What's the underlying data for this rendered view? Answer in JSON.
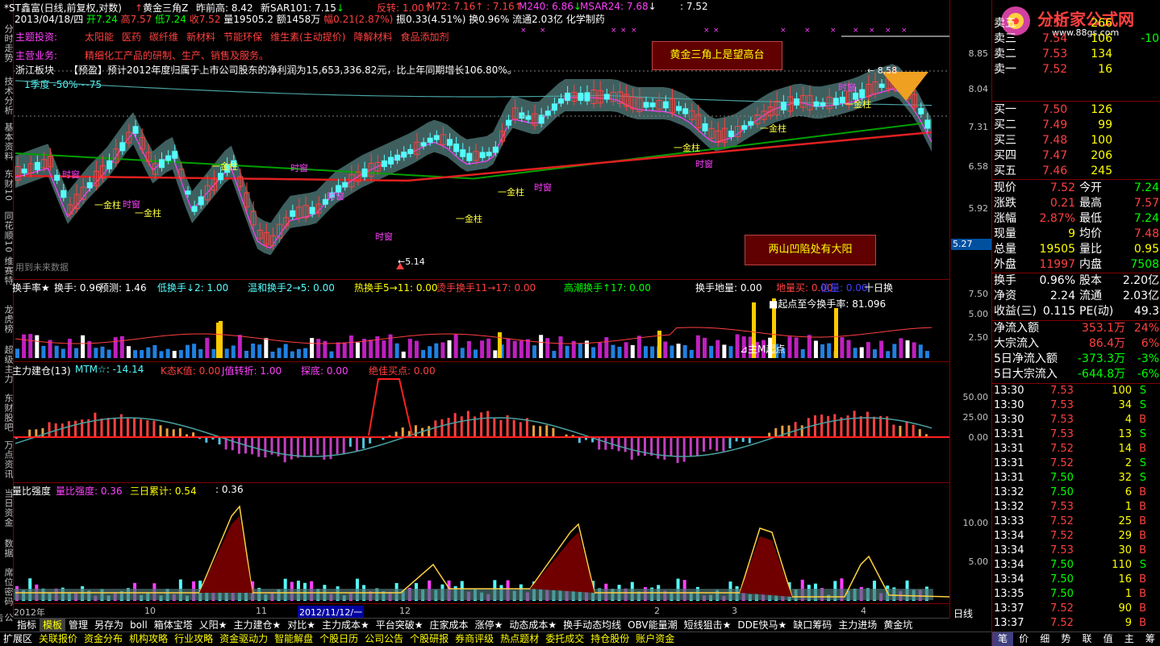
{
  "header": {
    "stock": "*ST鑫富(日线,前复权,对数)",
    "indicator": "黄金三角Z",
    "prev_high": "昨前高: 8.42",
    "sar": "新SAR101: 7.15",
    "reverse": "反转: 1.00",
    "m72": "M72: 7.16",
    "m72b": ": 7.16",
    "m240": "M240: 6.86",
    "msar": "MSAR24: 7.68",
    "val": ": 7.52",
    "line2": {
      "date": "2013/04/18/四",
      "open": "开7.24",
      "high": "高7.57",
      "low": "低7.24",
      "close": "收7.52",
      "vol": "量19505.2",
      "amt": "额1458万",
      "chg": "幅0.21(2.87%)",
      "amp": "振0.33(4.51%)",
      "turn": "换0.96%",
      "float": "流通2.03亿",
      "sector": "化学制药"
    }
  },
  "info": {
    "theme_label": "主题投资:",
    "themes": [
      "太阳能",
      "医药",
      "碳纤维",
      "新材料",
      "节能环保",
      "维生素(主动提价)",
      "降解材料",
      "食品添加剂"
    ],
    "biz_label": "主营业务:",
    "biz": "精细化工产品的研制、生产、销售及服务。",
    "region": "浙江板块",
    "forecast": "【预盈】预计2012年度归属于上市公司股东的净利润为15,653,336.82元，比上年同期增长106.80%。",
    "season": "1季度 -50%~-75",
    "future": "用到未来数据"
  },
  "annotations": {
    "box1": "黄金三角上是望高台",
    "box2": "两山凹陷处有大阳",
    "low": "5.14",
    "high": "8.58",
    "price_tag": "5.27",
    "jinzhu": "金柱",
    "shichuang": "时窗",
    "start_point": "主M起点"
  },
  "yaxis_main": [
    "8.85",
    "8.04",
    "7.31",
    "6.58",
    "5.92"
  ],
  "yaxis_turn": [
    "7.50",
    "5.00",
    "2.50"
  ],
  "yaxis_mtm": [
    "50.00",
    "25.00",
    "0.00"
  ],
  "yaxis_vr": [
    "10.00",
    "5.00"
  ],
  "panel2": {
    "title": "换手率★",
    "items": [
      "换手: 0.96",
      "预测: 1.46",
      "低换手↓2: 1.00",
      "温和换手2→5: 0.00",
      "热换手5→11: 0.00",
      "烫手换手11→17: 0.00",
      "高潮换手↑17: 0.00",
      "换手地量: 0.00",
      "地量买: 0.00",
      "信量: 0.00",
      "十日换"
    ],
    "sub": "■起点至今换手率: 81.096"
  },
  "panel3": {
    "title": "主力建仓(13)",
    "items": [
      "MTM☆: -14.14",
      "K态K值: 0.00",
      "J值转折: 1.00",
      "探底: 0.00",
      "绝佳买点: 0.00"
    ]
  },
  "panel4": {
    "title": "量比强度",
    "items": [
      "量比强度: 0.36",
      "三日累计: 0.54",
      ": 0.36"
    ]
  },
  "xaxis": [
    "2012年",
    "10",
    "11",
    "2012/11/12/一",
    "12",
    "2",
    "3",
    "4"
  ],
  "left_tabs": [
    "分时走势",
    "技术分析",
    "基本资料",
    "东财10",
    "同花顺10",
    "维赛特",
    "龙虎榜",
    "超级主力",
    "东财股吧",
    "万点资讯",
    "当日资金",
    "数据",
    "席位密码",
    "公告"
  ],
  "tabs": [
    "指标",
    "模板",
    "管理",
    "另存为",
    "boll",
    "箱体宝塔",
    "乂阳★",
    "主力建仓★",
    "对比★",
    "主力成本★",
    "平台突破★",
    "庄家成本",
    "涨停★",
    "动态成本★",
    "换手动态均线",
    "OBV能量潮",
    "短线狙击★",
    "DDE快马★",
    "缺口筹码",
    "主力进场",
    "黄金坑"
  ],
  "bottom_bar": [
    "扩展区",
    "关联报价",
    "资金分布",
    "机构攻略",
    "行业攻略",
    "资金驱动力",
    "智能解盘",
    "个股日历",
    "公司公告",
    "个股研报",
    "券商评级",
    "热点题材",
    "委托成交",
    "持仓股份",
    "账户资金"
  ],
  "period": "日线",
  "right_icons": [
    "笔",
    "价",
    "细",
    "势",
    "联",
    "值",
    "主",
    "筹"
  ],
  "logo": {
    "title": "分析家公式网",
    "url": "www.88gs.com"
  },
  "orderbook": {
    "asks": [
      {
        "label": "卖五",
        "price": "7.55",
        "vol": "266",
        "chg": ""
      },
      {
        "label": "卖三",
        "price": "7.54",
        "vol": "106",
        "chg": "-10"
      },
      {
        "label": "卖二",
        "price": "7.53",
        "vol": "134",
        "chg": ""
      },
      {
        "label": "卖一",
        "price": "7.52",
        "vol": "16",
        "chg": ""
      }
    ],
    "bids": [
      {
        "label": "买一",
        "price": "7.50",
        "vol": "126"
      },
      {
        "label": "买二",
        "price": "7.49",
        "vol": "99"
      },
      {
        "label": "买三",
        "price": "7.48",
        "vol": "100"
      },
      {
        "label": "买四",
        "price": "7.47",
        "vol": "206"
      },
      {
        "label": "买五",
        "price": "7.46",
        "vol": "245"
      }
    ]
  },
  "quote": [
    {
      "l1": "现价",
      "v1": "7.52",
      "l2": "今开",
      "v2": "7.24",
      "c1": "#ff4040",
      "c2": "#00ff00"
    },
    {
      "l1": "涨跌",
      "v1": "0.21",
      "l2": "最高",
      "v2": "7.57",
      "c1": "#ff4040",
      "c2": "#ff4040"
    },
    {
      "l1": "涨幅",
      "v1": "2.87%",
      "l2": "最低",
      "v2": "7.24",
      "c1": "#ff4040",
      "c2": "#00ff00"
    },
    {
      "l1": "现量",
      "v1": "9",
      "l2": "均价",
      "v2": "7.48",
      "c1": "#ffff00",
      "c2": "#ff4040"
    },
    {
      "l1": "总量",
      "v1": "19505",
      "l2": "量比",
      "v2": "0.95",
      "c1": "#ffff00",
      "c2": "#ffff00"
    },
    {
      "l1": "外盘",
      "v1": "11997",
      "l2": "内盘",
      "v2": "7508",
      "c1": "#ff4040",
      "c2": "#00ff00"
    }
  ],
  "fin": [
    {
      "l1": "换手",
      "v1": "0.96%",
      "l2": "股本",
      "v2": "2.20亿"
    },
    {
      "l1": "净资",
      "v1": "2.24",
      "l2": "流通",
      "v2": "2.03亿"
    },
    {
      "l1": "收益(三)",
      "v1": "0.115",
      "l2": "PE(动)",
      "v2": "49.3"
    }
  ],
  "flow": [
    {
      "l": "净流入额",
      "v": "353.1万",
      "p": "24%",
      "c": "#ff4040"
    },
    {
      "l": "大宗流入",
      "v": "86.4万",
      "p": "6%",
      "c": "#ff4040"
    },
    {
      "l": "5日净流入额",
      "v": "-373.3万",
      "p": "-3%",
      "c": "#00ff00"
    },
    {
      "l": "5日大宗流入",
      "v": "-644.8万",
      "p": "-6%",
      "c": "#00ff00"
    }
  ],
  "ticks": [
    [
      "13:30",
      "7.53",
      "100",
      "S"
    ],
    [
      "13:30",
      "7.53",
      "34",
      "S"
    ],
    [
      "13:30",
      "7.53",
      "4",
      "B"
    ],
    [
      "13:31",
      "7.53",
      "13",
      "S"
    ],
    [
      "13:31",
      "7.52",
      "14",
      "B"
    ],
    [
      "13:31",
      "7.52",
      "2",
      "S"
    ],
    [
      "13:31",
      "7.50",
      "32",
      "S"
    ],
    [
      "13:32",
      "7.50",
      "6",
      "B"
    ],
    [
      "13:32",
      "7.53",
      "1",
      "B"
    ],
    [
      "13:33",
      "7.52",
      "25",
      "B"
    ],
    [
      "13:34",
      "7.52",
      "29",
      "B"
    ],
    [
      "13:34",
      "7.53",
      "30",
      "B"
    ],
    [
      "13:34",
      "7.50",
      "110",
      "S"
    ],
    [
      "13:34",
      "7.50",
      "16",
      "B"
    ],
    [
      "13:35",
      "7.50",
      "1",
      "B"
    ],
    [
      "13:37",
      "7.52",
      "90",
      "B"
    ],
    [
      "13:37",
      "7.52",
      "9",
      "B"
    ]
  ],
  "colors": {
    "up": "#ff4040",
    "down": "#54fcfc",
    "panel_border": "#800000",
    "band": "#4a7070"
  }
}
